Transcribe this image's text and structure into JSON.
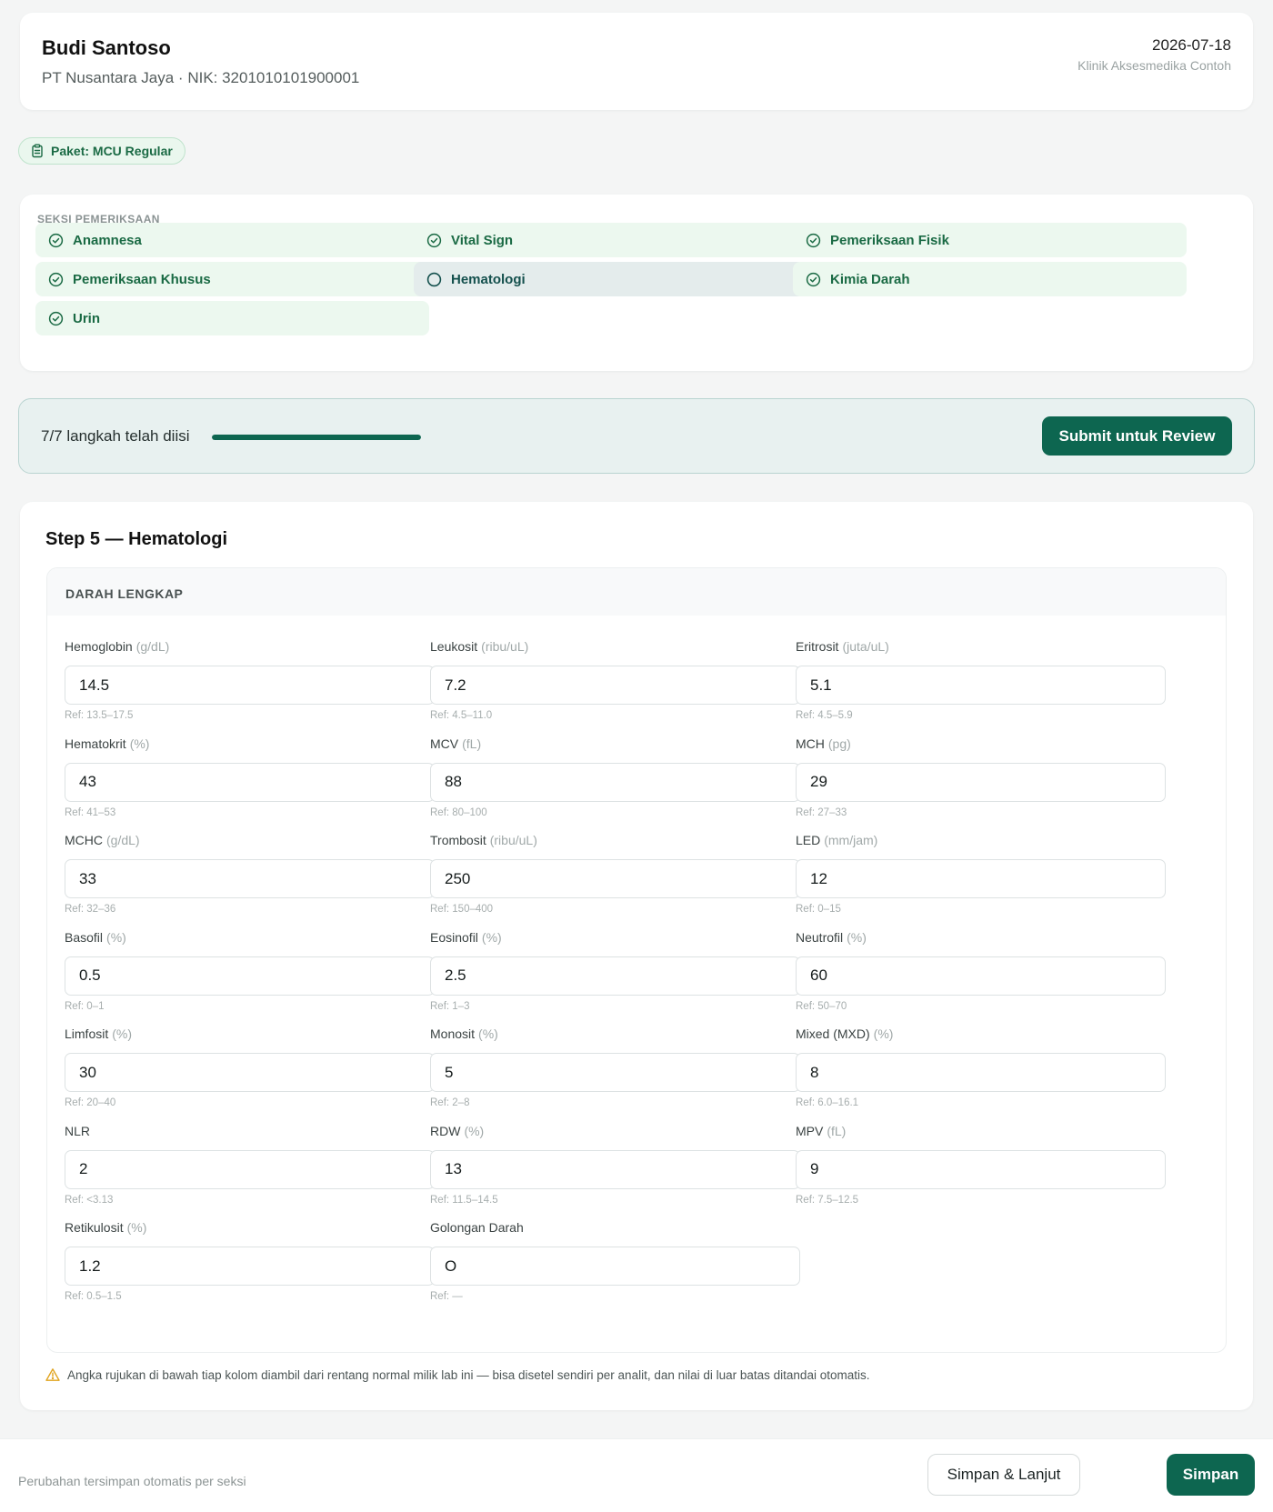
{
  "header": {
    "patient_name": "Budi Santoso",
    "patient_sub": "PT Nusantara Jaya · NIK: 3201010101900001",
    "date": "2026-07-18",
    "clinic": "Klinik Aksesmedika Contoh"
  },
  "package": {
    "label": "Paket: MCU Regular",
    "icon": "clipboard-icon"
  },
  "sections": {
    "title": "SEKSI PEMERIKSAAN",
    "items": [
      {
        "label": "Anamnesa",
        "status": "done"
      },
      {
        "label": "Vital Sign",
        "status": "done"
      },
      {
        "label": "Pemeriksaan Fisik",
        "status": "done"
      },
      {
        "label": "Pemeriksaan Khusus",
        "status": "done"
      },
      {
        "label": "Hematologi",
        "status": "active"
      },
      {
        "label": "Kimia Darah",
        "status": "done"
      },
      {
        "label": "Urin",
        "status": "done"
      }
    ]
  },
  "progress": {
    "text": "7/7 langkah telah diisi",
    "fraction": 1.0,
    "submit_label": "Submit untuk Review"
  },
  "step": {
    "title": "Step 5 — Hematologi",
    "panel_title": "DARAH LENGKAP",
    "fields": [
      {
        "label": "Hemoglobin",
        "unit": "(g/dL)",
        "value": "14.5",
        "ref": "Ref: 13.5–17.5"
      },
      {
        "label": "Leukosit",
        "unit": "(ribu/uL)",
        "value": "7.2",
        "ref": "Ref: 4.5–11.0"
      },
      {
        "label": "Eritrosit",
        "unit": "(juta/uL)",
        "value": "5.1",
        "ref": "Ref: 4.5–5.9"
      },
      {
        "label": "Hematokrit",
        "unit": "(%)",
        "value": "43",
        "ref": "Ref: 41–53"
      },
      {
        "label": "MCV",
        "unit": "(fL)",
        "value": "88",
        "ref": "Ref: 80–100"
      },
      {
        "label": "MCH",
        "unit": "(pg)",
        "value": "29",
        "ref": "Ref: 27–33"
      },
      {
        "label": "MCHC",
        "unit": "(g/dL)",
        "value": "33",
        "ref": "Ref: 32–36"
      },
      {
        "label": "Trombosit",
        "unit": "(ribu/uL)",
        "value": "250",
        "ref": "Ref: 150–400"
      },
      {
        "label": "LED",
        "unit": "(mm/jam)",
        "value": "12",
        "ref": "Ref: 0–15"
      },
      {
        "label": "Basofil",
        "unit": "(%)",
        "value": "0.5",
        "ref": "Ref: 0–1"
      },
      {
        "label": "Eosinofil",
        "unit": "(%)",
        "value": "2.5",
        "ref": "Ref: 1–3"
      },
      {
        "label": "Neutrofil",
        "unit": "(%)",
        "value": "60",
        "ref": "Ref: 50–70"
      },
      {
        "label": "Limfosit",
        "unit": "(%)",
        "value": "30",
        "ref": "Ref: 20–40"
      },
      {
        "label": "Monosit",
        "unit": "(%)",
        "value": "5",
        "ref": "Ref: 2–8"
      },
      {
        "label": "Mixed (MXD)",
        "unit": "(%)",
        "value": "8",
        "ref": "Ref: 6.0–16.1"
      },
      {
        "label": "NLR",
        "unit": "",
        "value": "2",
        "ref": "Ref: <3.13"
      },
      {
        "label": "RDW",
        "unit": "(%)",
        "value": "13",
        "ref": "Ref: 11.5–14.5"
      },
      {
        "label": "MPV",
        "unit": "(fL)",
        "value": "9",
        "ref": "Ref: 7.5–12.5"
      },
      {
        "label": "Retikulosit",
        "unit": "(%)",
        "value": "1.2",
        "ref": "Ref: 0.5–1.5"
      },
      {
        "label": "Golongan Darah",
        "unit": "",
        "value": "O",
        "ref": "Ref: —"
      }
    ],
    "note": "Angka rujukan di bawah tiap kolom diambil dari rentang normal milik lab ini — bisa disetel sendiri per analit, dan nilai di luar batas ditandai otomatis.",
    "note_icon": "warning-icon"
  },
  "footer": {
    "autosave": "Perubahan tersimpan otomatis per seksi",
    "save_next_label": "Simpan & Lanjut",
    "save_label": "Simpan"
  },
  "colors": {
    "primary": "#0d6650",
    "done_text": "#1a6a44",
    "done_bg": "#ecf8ef",
    "active_bg": "#e4ecec",
    "warning": "#e0a21b"
  }
}
